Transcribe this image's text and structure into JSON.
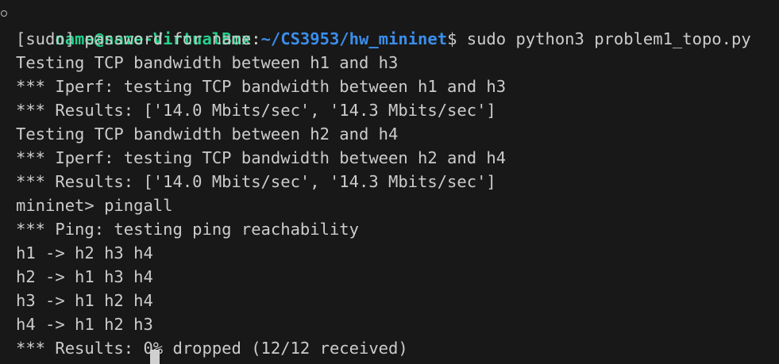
{
  "prompt": {
    "user_host": "name@name-VirtualBox",
    "separator": ":",
    "path": "~/CS3953/hw_mininet",
    "symbol": "$",
    "command": " sudo python3 problem1_topo.py"
  },
  "output_lines": [
    "[sudo] password for name:",
    "Testing TCP bandwidth between h1 and h3",
    "*** Iperf: testing TCP bandwidth between h1 and h3",
    "*** Results: ['14.0 Mbits/sec', '14.3 Mbits/sec']",
    "Testing TCP bandwidth between h2 and h4",
    "*** Iperf: testing TCP bandwidth between h2 and h4",
    "*** Results: ['14.0 Mbits/sec', '14.3 Mbits/sec']",
    "mininet> pingall",
    "*** Ping: testing ping reachability",
    "h1 -> h2 h3 h4",
    "h2 -> h1 h3 h4",
    "h3 -> h1 h2 h4",
    "h4 -> h1 h2 h3",
    "*** Results: 0% dropped (12/12 received)"
  ],
  "colors": {
    "background": "#181818",
    "text": "#cccccc",
    "user_host": "#23d18b",
    "path": "#3b8eea"
  }
}
